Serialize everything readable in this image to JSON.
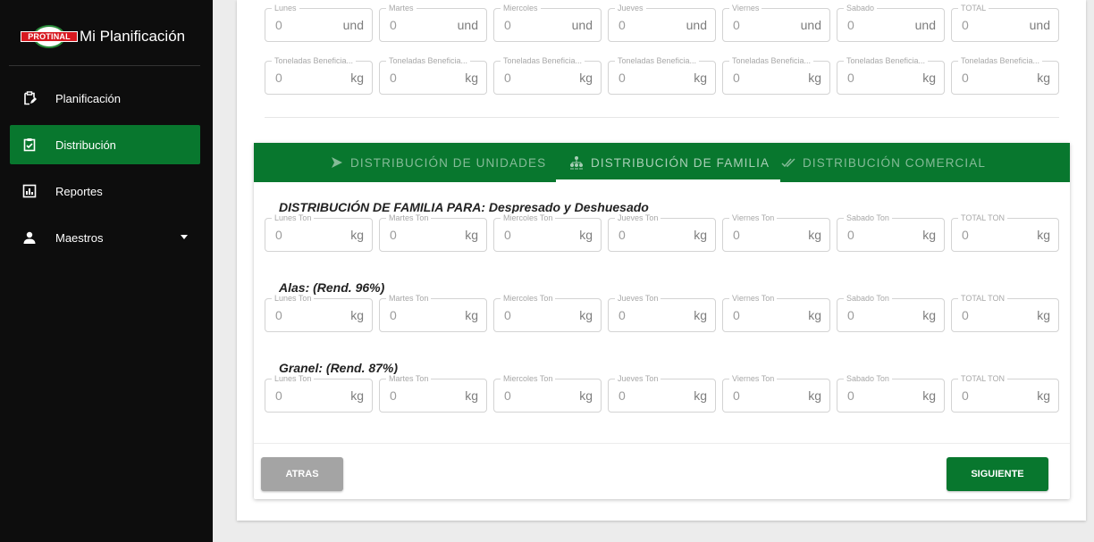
{
  "brand": {
    "logo_text": "PROTINAL",
    "title": "Mi Planificación"
  },
  "sidebar": {
    "items": [
      {
        "label": "Planificación",
        "icon": "clipboard-edit-icon",
        "active": false
      },
      {
        "label": "Distribución",
        "icon": "clipboard-check-icon",
        "active": true
      },
      {
        "label": "Reportes",
        "icon": "bar-chart-icon",
        "active": false
      },
      {
        "label": "Maestros",
        "icon": "person-icon",
        "active": false,
        "has_dropdown": true
      }
    ]
  },
  "units_row": {
    "fields": [
      {
        "label": "Lunes",
        "value": "0",
        "unit": "und"
      },
      {
        "label": "Martes",
        "value": "0",
        "unit": "und"
      },
      {
        "label": "Miercoles",
        "value": "0",
        "unit": "und"
      },
      {
        "label": "Jueves",
        "value": "0",
        "unit": "und"
      },
      {
        "label": "Viernes",
        "value": "0",
        "unit": "und"
      },
      {
        "label": "Sabado",
        "value": "0",
        "unit": "und"
      },
      {
        "label": "TOTAL",
        "value": "0",
        "unit": "und"
      }
    ]
  },
  "tonnage_row": {
    "fields": [
      {
        "label": "Toneladas Beneficia...",
        "value": "0",
        "unit": "kg"
      },
      {
        "label": "Toneladas Beneficia...",
        "value": "0",
        "unit": "kg"
      },
      {
        "label": "Toneladas Beneficia...",
        "value": "0",
        "unit": "kg"
      },
      {
        "label": "Toneladas Beneficia...",
        "value": "0",
        "unit": "kg"
      },
      {
        "label": "Toneladas Beneficia...",
        "value": "0",
        "unit": "kg"
      },
      {
        "label": "Toneladas Beneficia...",
        "value": "0",
        "unit": "kg"
      },
      {
        "label": "Toneladas Beneficia...",
        "value": "0",
        "unit": "kg"
      }
    ]
  },
  "tabs": [
    {
      "label": "DISTRIBUCIÓN DE UNIDADES",
      "icon": "send-icon",
      "active": false
    },
    {
      "label": "DISTRIBUCIÓN DE FAMILIA",
      "icon": "family-tree-icon",
      "active": true
    },
    {
      "label": "DISTRIBUCIÓN COMERCIAL",
      "icon": "double-check-icon",
      "active": false
    }
  ],
  "family_sections": [
    {
      "title": "DISTRIBUCIÓN DE FAMILIA PARA: Despresado y Deshuesado",
      "fields": [
        {
          "label": "Lunes Ton",
          "value": "0",
          "unit": "kg"
        },
        {
          "label": "Martes Ton",
          "value": "0",
          "unit": "kg"
        },
        {
          "label": "Miercoles Ton",
          "value": "0",
          "unit": "kg"
        },
        {
          "label": "Jueves Ton",
          "value": "0",
          "unit": "kg"
        },
        {
          "label": "Viernes Ton",
          "value": "0",
          "unit": "kg"
        },
        {
          "label": "Sabado Ton",
          "value": "0",
          "unit": "kg"
        },
        {
          "label": "TOTAL TON",
          "value": "0",
          "unit": "kg"
        }
      ]
    },
    {
      "title": "Alas: (Rend. 96%)",
      "fields": [
        {
          "label": "Lunes Ton",
          "value": "0",
          "unit": "kg"
        },
        {
          "label": "Martes Ton",
          "value": "0",
          "unit": "kg"
        },
        {
          "label": "Miercoles Ton",
          "value": "0",
          "unit": "kg"
        },
        {
          "label": "Jueves Ton",
          "value": "0",
          "unit": "kg"
        },
        {
          "label": "Viernes Ton",
          "value": "0",
          "unit": "kg"
        },
        {
          "label": "Sabado Ton",
          "value": "0",
          "unit": "kg"
        },
        {
          "label": "TOTAL TON",
          "value": "0",
          "unit": "kg"
        }
      ]
    },
    {
      "title": "Granel: (Rend. 87%)",
      "fields": [
        {
          "label": "Lunes Ton",
          "value": "0",
          "unit": "kg"
        },
        {
          "label": "Martes Ton",
          "value": "0",
          "unit": "kg"
        },
        {
          "label": "Miercoles Ton",
          "value": "0",
          "unit": "kg"
        },
        {
          "label": "Jueves Ton",
          "value": "0",
          "unit": "kg"
        },
        {
          "label": "Viernes Ton",
          "value": "0",
          "unit": "kg"
        },
        {
          "label": "Sabado Ton",
          "value": "0",
          "unit": "kg"
        },
        {
          "label": "TOTAL TON",
          "value": "0",
          "unit": "kg"
        }
      ]
    }
  ],
  "buttons": {
    "back": "ATRAS",
    "next": "SIGUIENTE"
  },
  "colors": {
    "primary": "#08772e",
    "sidebar_bg": "#0d0d0d",
    "disabled_button": "#a4a4a4",
    "logo_red": "#d71920"
  }
}
